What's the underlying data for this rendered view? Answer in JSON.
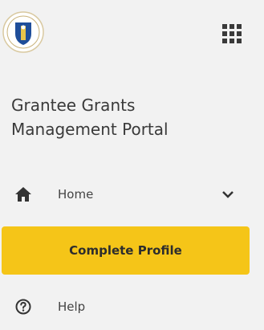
{
  "header": {
    "seal_icon": "state-seal-icon",
    "apps_icon": "grid-apps-icon"
  },
  "portal": {
    "title_line1": "Grantee Grants",
    "title_line2": "Management Portal"
  },
  "nav": {
    "home": {
      "label": "Home",
      "icon": "home-icon",
      "expand_icon": "chevron-down-icon"
    },
    "complete_profile": {
      "label": "Complete Profile"
    },
    "help": {
      "label": "Help",
      "icon": "question-circle-icon"
    }
  },
  "colors": {
    "background": "#f2f2f2",
    "accent": "#f5c518",
    "text": "#333333"
  }
}
